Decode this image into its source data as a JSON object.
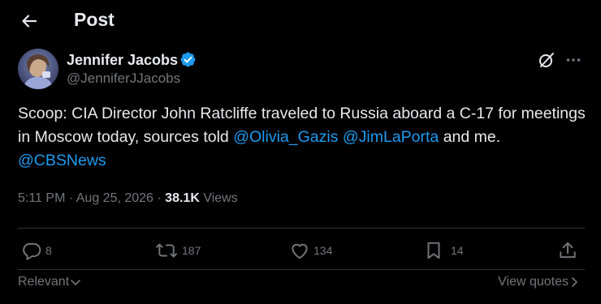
{
  "header": {
    "title": "Post"
  },
  "author": {
    "name": "Jennifer Jacobs",
    "handle": "@JenniferJJacobs",
    "verified": true
  },
  "tweet": {
    "text_part1": "Scoop: CIA Director John Ratcliffe traveled to Russia aboard a C-17 for meetings in Moscow today, sources told ",
    "mention1": "@Olivia_Gazis",
    "text_part2": " ",
    "mention2": "@JimLaPorta",
    "text_part3": " and me. ",
    "mention3": "@CBSNews"
  },
  "meta": {
    "time": "5:11 PM",
    "separator": " · ",
    "date": "Aug 25, 2026",
    "views_count": "38.1K",
    "views_label": " Views"
  },
  "actions": {
    "replies": "8",
    "reposts": "187",
    "likes": "134",
    "bookmarks": "14"
  },
  "footer": {
    "sort_label": "Relevant",
    "quotes_label": "View quotes"
  },
  "colors": {
    "background": "#000000",
    "text": "#e7e9ea",
    "muted": "#71767b",
    "accent": "#1d9bf0",
    "divider": "#2f3336"
  },
  "icons": [
    "back-arrow-icon",
    "verified-badge-icon",
    "grok-icon",
    "more-icon",
    "reply-icon",
    "repost-icon",
    "like-icon",
    "bookmark-icon",
    "share-icon",
    "chevron-down-icon",
    "chevron-right-icon"
  ]
}
